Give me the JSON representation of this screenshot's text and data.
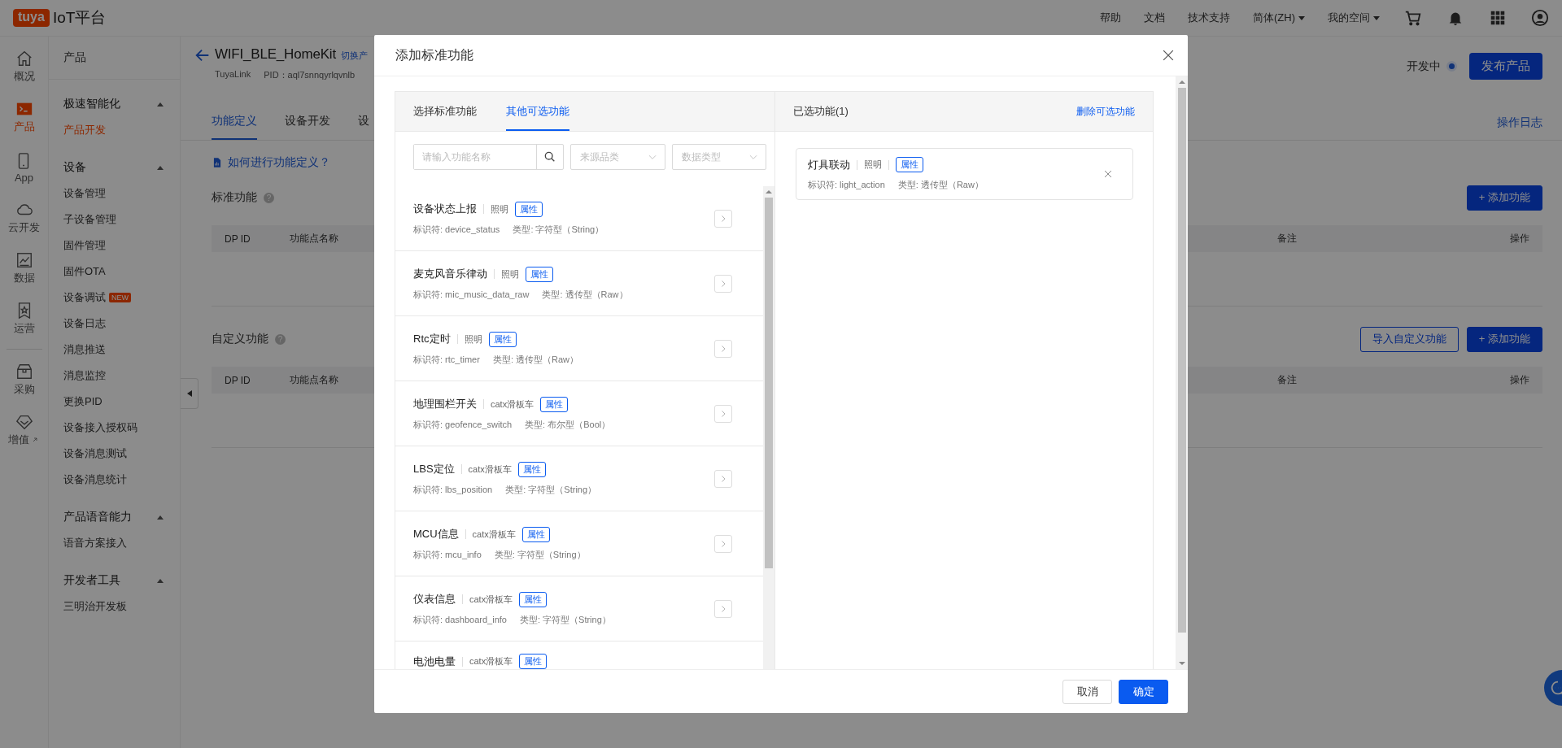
{
  "top_bar": {
    "logo_badge": "tuya",
    "logo_text": "IoT平台",
    "menu": [
      {
        "label": "帮助",
        "dropdown": false
      },
      {
        "label": "文档",
        "dropdown": false
      },
      {
        "label": "技术支持",
        "dropdown": false
      },
      {
        "label": "简体(ZH)",
        "dropdown": true
      },
      {
        "label": "我的空间",
        "dropdown": true
      }
    ]
  },
  "rail": [
    {
      "label": "概况",
      "selected": false,
      "external": false
    },
    {
      "label": "产品",
      "selected": true,
      "external": false
    },
    {
      "label": "App",
      "selected": false,
      "external": false
    },
    {
      "label": "云开发",
      "selected": false,
      "external": false
    },
    {
      "label": "数据",
      "selected": false,
      "external": false
    },
    {
      "label": "运营",
      "selected": false,
      "external": false
    },
    {
      "label": "采购",
      "selected": false,
      "external": false
    },
    {
      "label": "增值",
      "selected": false,
      "external": true
    }
  ],
  "sidebar": {
    "title": "产品",
    "groups": [
      {
        "label": "极速智能化",
        "expanded": true,
        "items": [
          {
            "label": "产品开发",
            "selected": true
          }
        ]
      },
      {
        "label": "设备",
        "expanded": true,
        "items": [
          {
            "label": "设备管理",
            "selected": false
          },
          {
            "label": "子设备管理",
            "selected": false
          },
          {
            "label": "固件管理",
            "selected": false
          },
          {
            "label": "固件OTA",
            "selected": false
          },
          {
            "label": "设备调试",
            "selected": false,
            "badge": "NEW"
          },
          {
            "label": "设备日志",
            "selected": false
          },
          {
            "label": "消息推送",
            "selected": false
          },
          {
            "label": "消息监控",
            "selected": false
          },
          {
            "label": "更换PID",
            "selected": false
          },
          {
            "label": "设备接入授权码",
            "selected": false
          },
          {
            "label": "设备消息测试",
            "selected": false
          },
          {
            "label": "设备消息统计",
            "selected": false
          }
        ]
      },
      {
        "label": "产品语音能力",
        "expanded": true,
        "items": [
          {
            "label": "语音方案接入",
            "selected": false
          }
        ]
      },
      {
        "label": "开发者工具",
        "expanded": true,
        "items": [
          {
            "label": "三明治开发板",
            "selected": false
          }
        ]
      }
    ]
  },
  "product": {
    "name": "WIFI_BLE_HomeKit",
    "switch_link": "切换产",
    "protocol": "TuyaLink",
    "pid": "PID：aql7snnqyrlqvnlb",
    "status": "开发中",
    "publish": "发布产品",
    "log": "操作日志",
    "tabs": [
      {
        "label": "功能定义",
        "selected": true
      },
      {
        "label": "设备开发",
        "selected": false
      },
      {
        "label": "设",
        "selected": false
      }
    ]
  },
  "help_link": "如何进行功能定义？",
  "sections": [
    {
      "title": "标准功能",
      "help_icon": "?",
      "buttons": [
        {
          "label": "+ 添加功能",
          "kind": "primary"
        }
      ],
      "columns": [
        "DP ID",
        "功能点名称",
        "备注",
        "操作"
      ]
    },
    {
      "title": "自定义功能",
      "help_icon": "?",
      "buttons": [
        {
          "label": "导入自定义功能",
          "kind": "outline"
        },
        {
          "label": "+ 添加功能",
          "kind": "primary"
        }
      ],
      "columns": [
        "DP ID",
        "功能点名称",
        "备注",
        "操作"
      ]
    }
  ],
  "modal": {
    "title": "添加标准功能",
    "tabs": [
      {
        "label": "选择标准功能",
        "selected": false
      },
      {
        "label": "其他可选功能",
        "selected": true
      }
    ],
    "search": {
      "placeholder": "请输入功能名称"
    },
    "filters": [
      {
        "placeholder": "来源品类"
      },
      {
        "placeholder": "数据类型"
      }
    ],
    "functions": [
      {
        "name": "设备状态上报",
        "category": "照明",
        "tag": "属性",
        "identifier": "标识符: device_status",
        "type": "类型: 字符型（String）"
      },
      {
        "name": "麦克风音乐律动",
        "category": "照明",
        "tag": "属性",
        "identifier": "标识符: mic_music_data_raw",
        "type": "类型: 透传型（Raw）"
      },
      {
        "name": "Rtc定时",
        "category": "照明",
        "tag": "属性",
        "identifier": "标识符: rtc_timer",
        "type": "类型: 透传型（Raw）"
      },
      {
        "name": "地理围栏开关",
        "category": "catx滑板车",
        "tag": "属性",
        "identifier": "标识符: geofence_switch",
        "type": "类型: 布尔型（Bool）"
      },
      {
        "name": "LBS定位",
        "category": "catx滑板车",
        "tag": "属性",
        "identifier": "标识符: lbs_position",
        "type": "类型: 字符型（String）"
      },
      {
        "name": "MCU信息",
        "category": "catx滑板车",
        "tag": "属性",
        "identifier": "标识符: mcu_info",
        "type": "类型: 字符型（String）"
      },
      {
        "name": "仪表信息",
        "category": "catx滑板车",
        "tag": "属性",
        "identifier": "标识符: dashboard_info",
        "type": "类型: 字符型（String）"
      },
      {
        "name": "电池电量",
        "category": "catx滑板车",
        "tag": "属性"
      }
    ],
    "selected_header": "已选功能(1)",
    "remove_link": "删除可选功能",
    "chosen": [
      {
        "name": "灯具联动",
        "category": "照明",
        "tag": "属性",
        "identifier": "标识符: light_action",
        "type": "类型: 透传型（Raw）"
      }
    ],
    "buttons": [
      {
        "label": "取消",
        "kind": "default"
      },
      {
        "label": "确定",
        "kind": "primary"
      }
    ]
  }
}
